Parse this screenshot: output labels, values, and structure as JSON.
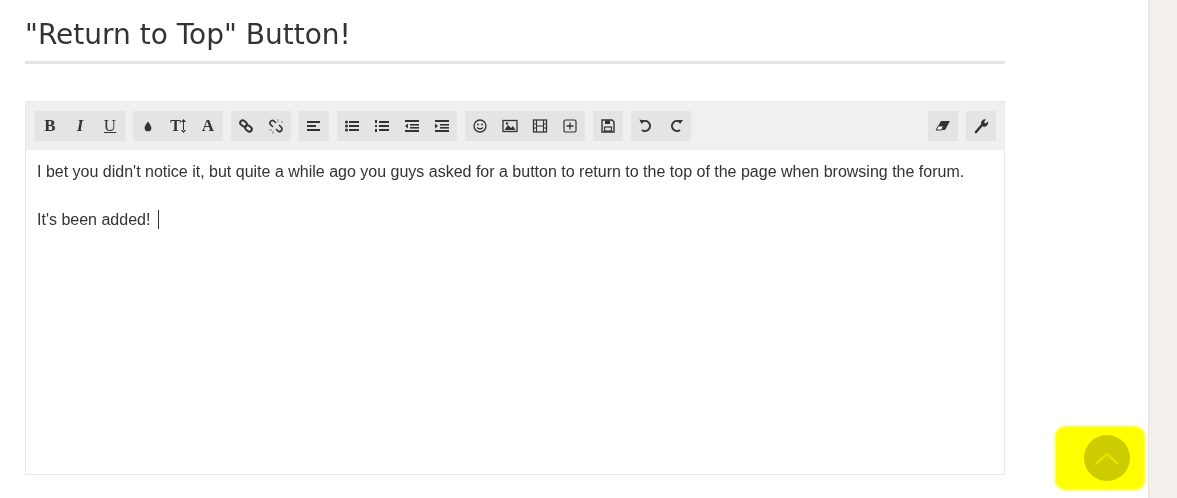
{
  "title": "\"Return to Top\" Button!",
  "toolbar": {
    "text_buttons": [
      "B",
      "I",
      "U",
      "T",
      "A"
    ]
  },
  "editor": {
    "paragraphs": [
      "I bet you didn't notice it, but quite a while ago you guys asked for a button to return to the top of the page when browsing the forum.",
      "It's been added!"
    ],
    "cursor": true
  },
  "scroll_top_button": {
    "highlighted": true
  }
}
